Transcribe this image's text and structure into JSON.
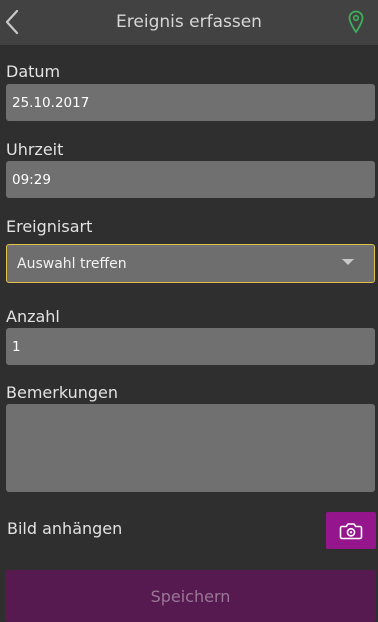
{
  "header": {
    "title": "Ereignis erfassen",
    "back_icon": "chevron-left-icon",
    "location_icon": "map-pin-icon"
  },
  "form": {
    "datum": {
      "label": "Datum",
      "value": "25.10.2017"
    },
    "uhrzeit": {
      "label": "Uhrzeit",
      "value": "09:29"
    },
    "ereignisart": {
      "label": "Ereignisart",
      "value": "Auswahl treffen"
    },
    "anzahl": {
      "label": "Anzahl",
      "value": "1"
    },
    "bemerkungen": {
      "label": "Bemerkungen",
      "value": ""
    },
    "attach": {
      "label": "Bild anhängen",
      "icon": "camera-icon"
    }
  },
  "actions": {
    "save_label": "Speichern"
  },
  "colors": {
    "accent_select_border": "#e4c14a",
    "location_icon": "#3fae5a",
    "camera_button": "#95158d",
    "save_button": "#561a51"
  }
}
